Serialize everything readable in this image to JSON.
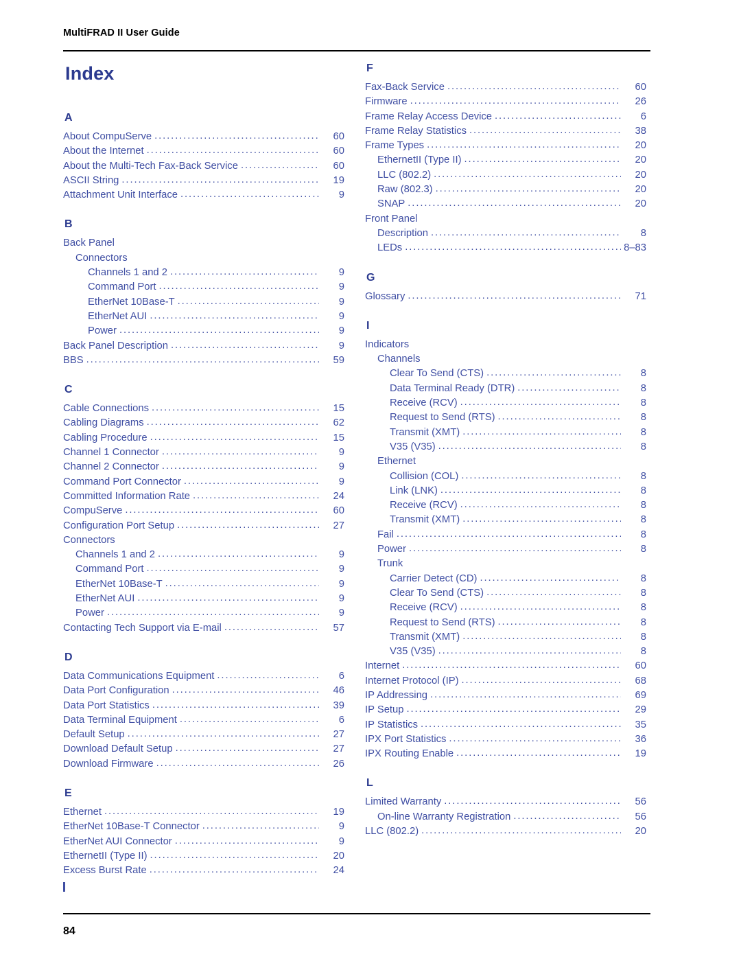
{
  "header": {
    "running_head": "MultiFRAD II User Guide",
    "page_number": "84"
  },
  "title": "Index",
  "columns": [
    {
      "id": "left",
      "sections": [
        {
          "letter": "A",
          "entries": [
            {
              "level": 1,
              "text": "About CompuServe",
              "page": "60"
            },
            {
              "level": 1,
              "text": "About the Internet",
              "page": "60"
            },
            {
              "level": 1,
              "text": "About the Multi-Tech Fax-Back Service",
              "page": "60"
            },
            {
              "level": 1,
              "text": "ASCII String",
              "page": "19"
            },
            {
              "level": 1,
              "text": "Attachment Unit Interface",
              "page": "9"
            }
          ]
        },
        {
          "letter": "B",
          "entries": [
            {
              "level": 1,
              "text": "Back Panel",
              "page": ""
            },
            {
              "level": 2,
              "text": "Connectors",
              "page": ""
            },
            {
              "level": 3,
              "text": "Channels 1 and 2",
              "page": "9"
            },
            {
              "level": 3,
              "text": "Command Port",
              "page": "9"
            },
            {
              "level": 3,
              "text": "EtherNet 10Base-T",
              "page": "9"
            },
            {
              "level": 3,
              "text": "EtherNet AUI",
              "page": "9"
            },
            {
              "level": 3,
              "text": "Power",
              "page": "9"
            },
            {
              "level": 1,
              "text": "Back Panel Description",
              "page": "9"
            },
            {
              "level": 1,
              "text": "BBS",
              "page": "59"
            }
          ]
        },
        {
          "letter": "C",
          "entries": [
            {
              "level": 1,
              "text": "Cable Connections",
              "page": "15"
            },
            {
              "level": 1,
              "text": "Cabling Diagrams",
              "page": "62"
            },
            {
              "level": 1,
              "text": "Cabling Procedure",
              "page": "15"
            },
            {
              "level": 1,
              "text": "Channel 1 Connector",
              "page": "9"
            },
            {
              "level": 1,
              "text": "Channel 2 Connector",
              "page": "9"
            },
            {
              "level": 1,
              "text": "Command Port Connector",
              "page": "9"
            },
            {
              "level": 1,
              "text": "Committed Information Rate",
              "page": "24"
            },
            {
              "level": 1,
              "text": "CompuServe",
              "page": "60"
            },
            {
              "level": 1,
              "text": "Configuration Port Setup",
              "page": "27"
            },
            {
              "level": 1,
              "text": "Connectors",
              "page": ""
            },
            {
              "level": 2,
              "text": "Channels 1 and 2",
              "page": "9"
            },
            {
              "level": 2,
              "text": "Command Port",
              "page": "9"
            },
            {
              "level": 2,
              "text": "EtherNet 10Base-T",
              "page": "9"
            },
            {
              "level": 2,
              "text": "EtherNet AUI",
              "page": "9"
            },
            {
              "level": 2,
              "text": "Power",
              "page": "9"
            },
            {
              "level": 1,
              "text": "Contacting Tech Support via E-mail",
              "page": "57"
            }
          ]
        },
        {
          "letter": "D",
          "entries": [
            {
              "level": 1,
              "text": "Data Communications Equipment",
              "page": "6"
            },
            {
              "level": 1,
              "text": "Data Port Configuration",
              "page": "46"
            },
            {
              "level": 1,
              "text": "Data Port Statistics",
              "page": "39"
            },
            {
              "level": 1,
              "text": "Data Terminal Equipment",
              "page": "6"
            },
            {
              "level": 1,
              "text": "Default Setup",
              "page": "27"
            },
            {
              "level": 1,
              "text": "Download Default Setup",
              "page": "27"
            },
            {
              "level": 1,
              "text": "Download Firmware",
              "page": "26"
            }
          ]
        },
        {
          "letter": "E",
          "entries": [
            {
              "level": 1,
              "text": "Ethernet",
              "page": "19"
            },
            {
              "level": 1,
              "text": "EtherNet 10Base-T Connector",
              "page": "9"
            },
            {
              "level": 1,
              "text": "EtherNet AUI Connector",
              "page": "9"
            },
            {
              "level": 1,
              "text": "EthernetII (Type II)",
              "page": "20"
            },
            {
              "level": 1,
              "text": "Excess Burst Rate",
              "page": "24"
            }
          ]
        }
      ]
    },
    {
      "id": "right",
      "sections": [
        {
          "letter": "F",
          "entries": [
            {
              "level": 1,
              "text": "Fax-Back Service",
              "page": "60"
            },
            {
              "level": 1,
              "text": "Firmware",
              "page": "26"
            },
            {
              "level": 1,
              "text": "Frame Relay Access Device",
              "page": "6"
            },
            {
              "level": 1,
              "text": "Frame Relay Statistics",
              "page": "38"
            },
            {
              "level": 1,
              "text": "Frame Types",
              "page": "20"
            },
            {
              "level": 2,
              "text": "EthernetII (Type II)",
              "page": "20"
            },
            {
              "level": 2,
              "text": "LLC (802.2)",
              "page": "20"
            },
            {
              "level": 2,
              "text": "Raw (802.3)",
              "page": "20"
            },
            {
              "level": 2,
              "text": "SNAP",
              "page": "20"
            },
            {
              "level": 1,
              "text": "Front Panel",
              "page": ""
            },
            {
              "level": 2,
              "text": "Description",
              "page": "8"
            },
            {
              "level": 2,
              "text": "LEDs",
              "page": "8–83"
            }
          ]
        },
        {
          "letter": "G",
          "entries": [
            {
              "level": 1,
              "text": "Glossary",
              "page": "71"
            }
          ]
        },
        {
          "letter": "I",
          "entries": [
            {
              "level": 1,
              "text": "Indicators",
              "page": ""
            },
            {
              "level": 2,
              "text": "Channels",
              "page": ""
            },
            {
              "level": 3,
              "text": "Clear To Send (CTS)",
              "page": "8"
            },
            {
              "level": 3,
              "text": "Data Terminal Ready (DTR)",
              "page": "8"
            },
            {
              "level": 3,
              "text": "Receive (RCV)",
              "page": "8"
            },
            {
              "level": 3,
              "text": "Request to Send (RTS)",
              "page": "8"
            },
            {
              "level": 3,
              "text": "Transmit (XMT)",
              "page": "8"
            },
            {
              "level": 3,
              "text": "V35 (V35)",
              "page": "8"
            },
            {
              "level": 2,
              "text": "Ethernet",
              "page": ""
            },
            {
              "level": 3,
              "text": "Collision (COL)",
              "page": "8"
            },
            {
              "level": 3,
              "text": "Link (LNK)",
              "page": "8"
            },
            {
              "level": 3,
              "text": "Receive (RCV)",
              "page": "8"
            },
            {
              "level": 3,
              "text": "Transmit (XMT)",
              "page": "8"
            },
            {
              "level": 2,
              "text": "Fail",
              "page": "8"
            },
            {
              "level": 2,
              "text": "Power",
              "page": "8"
            },
            {
              "level": 2,
              "text": "Trunk",
              "page": ""
            },
            {
              "level": 3,
              "text": "Carrier Detect (CD)",
              "page": "8"
            },
            {
              "level": 3,
              "text": "Clear To Send (CTS)",
              "page": "8"
            },
            {
              "level": 3,
              "text": "Receive (RCV)",
              "page": "8"
            },
            {
              "level": 3,
              "text": "Request to Send (RTS)",
              "page": "8"
            },
            {
              "level": 3,
              "text": "Transmit (XMT)",
              "page": "8"
            },
            {
              "level": 3,
              "text": "V35 (V35)",
              "page": "8"
            },
            {
              "level": 1,
              "text": "Internet",
              "page": "60"
            },
            {
              "level": 1,
              "text": "Internet Protocol (IP)",
              "page": "68"
            },
            {
              "level": 1,
              "text": "IP Addressing",
              "page": "69"
            },
            {
              "level": 1,
              "text": "IP Setup",
              "page": "29"
            },
            {
              "level": 1,
              "text": "IP Statistics",
              "page": "35"
            },
            {
              "level": 1,
              "text": "IPX Port Statistics",
              "page": "36"
            },
            {
              "level": 1,
              "text": "IPX Routing Enable",
              "page": "19"
            }
          ]
        },
        {
          "letter": "L",
          "entries": [
            {
              "level": 1,
              "text": "Limited Warranty",
              "page": "56"
            },
            {
              "level": 2,
              "text": "On-line Warranty Registration",
              "page": "56"
            },
            {
              "level": 1,
              "text": "LLC (802.2)",
              "page": "20"
            }
          ]
        }
      ]
    }
  ]
}
